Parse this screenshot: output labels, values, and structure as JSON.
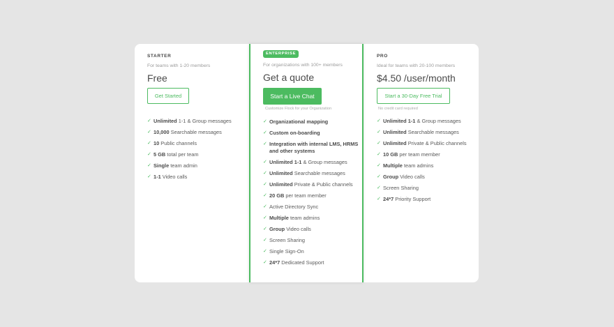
{
  "plans": {
    "starter": {
      "name": "STARTER",
      "subtitle": "For teams with 1-20 members",
      "price": "Free",
      "button": "Get Started",
      "features": [
        {
          "bold": "Unlimited",
          "text": " 1-1 & Group messages"
        },
        {
          "bold": "10,000",
          "text": " Searchable messages"
        },
        {
          "bold": "10",
          "text": " Public channels"
        },
        {
          "bold": "5 GB",
          "text": " total per team"
        },
        {
          "bold": "Single",
          "text": " team admin"
        },
        {
          "bold": "1-1",
          "text": " Video calls"
        }
      ]
    },
    "enterprise": {
      "badge": "ENTERPRISE",
      "subtitle": "For organizations with 100+ members",
      "price": "Get a quote",
      "button": "Start a Live Chat",
      "note": "Customize Flock for your Organization",
      "features": [
        {
          "bold": "Organizational mapping",
          "text": ""
        },
        {
          "bold": "Custom on-boarding",
          "text": ""
        },
        {
          "bold": "Integration with internal LMS, HRMS and other systems",
          "text": ""
        },
        {
          "bold": "Unlimited 1-1",
          "text": " & Group messages"
        },
        {
          "bold": "Unlimited",
          "text": " Searchable messages"
        },
        {
          "bold": "Unlimited",
          "text": " Private & Public channels"
        },
        {
          "bold": "20 GB",
          "text": " per team member"
        },
        {
          "bold": "",
          "text": "Active Directory Sync"
        },
        {
          "bold": "Multiple",
          "text": " team admins"
        },
        {
          "bold": "Group",
          "text": " Video calls"
        },
        {
          "bold": "",
          "text": "Screen Sharing"
        },
        {
          "bold": "",
          "text": "Single Sign-On"
        },
        {
          "bold": "24*7",
          "text": " Dedicated Support"
        }
      ]
    },
    "pro": {
      "name": "PRO",
      "subtitle": "Ideal for teams with 20-100 members",
      "price": "$4.50 /user/month",
      "button": "Start a 30-Day Free Trial",
      "note": "No credit card required",
      "features": [
        {
          "bold": "Unlimited 1-1",
          "text": " & Group messages"
        },
        {
          "bold": "Unlimited",
          "text": " Searchable messages"
        },
        {
          "bold": "Unlimited",
          "text": " Private & Public channels"
        },
        {
          "bold": "10 GB",
          "text": " per team member"
        },
        {
          "bold": "Multiple",
          "text": " team admins"
        },
        {
          "bold": "Group",
          "text": " Video calls"
        },
        {
          "bold": "",
          "text": "Screen Sharing"
        },
        {
          "bold": "24*7",
          "text": " Priority Support"
        }
      ]
    }
  },
  "icons": {
    "check": "check-icon"
  },
  "colors": {
    "accent": "#4cbb60",
    "background": "#e5e5e5",
    "card": "#ffffff"
  }
}
